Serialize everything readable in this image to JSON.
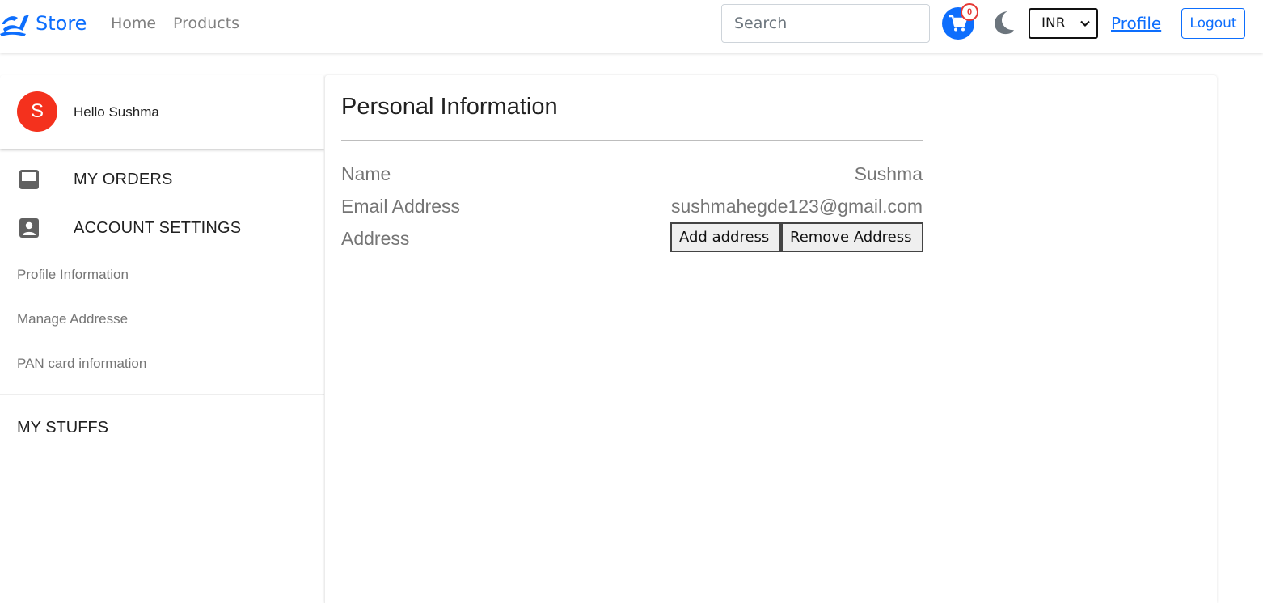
{
  "navbar": {
    "brand": "Store",
    "links": {
      "home": "Home",
      "products": "Products"
    },
    "search": {
      "placeholder": "Search",
      "value": ""
    },
    "cart": {
      "count": "0"
    },
    "currency": {
      "selected": "INR"
    },
    "profile_link": "Profile",
    "logout_label": "Logout",
    "colors": {
      "primary": "#0d6efd",
      "badge": "#e53935"
    },
    "icons": {
      "cart": "shopping-cart-icon",
      "theme": "moon-icon"
    }
  },
  "sidebar": {
    "avatar_initial": "S",
    "avatar_color": "#f4311d",
    "greeting": "Hello Sushma",
    "orders_label": "MY ORDERS",
    "settings_label": "ACCOUNT SETTINGS",
    "settings_items": [
      "Profile Information",
      "Manage Addresse",
      "PAN card information"
    ],
    "stuffs_label": "MY STUFFS",
    "icons": {
      "orders": "inbox-icon",
      "settings": "account-box-icon"
    }
  },
  "main": {
    "title": "Personal Information",
    "fields": {
      "name_label": "Name",
      "name_value": "Sushma",
      "email_label": "Email Address",
      "email_value": "sushmahegde123@gmail.com",
      "address_label": "Address"
    },
    "buttons": {
      "add_address": "Add address",
      "remove_address": "Remove Address"
    }
  }
}
